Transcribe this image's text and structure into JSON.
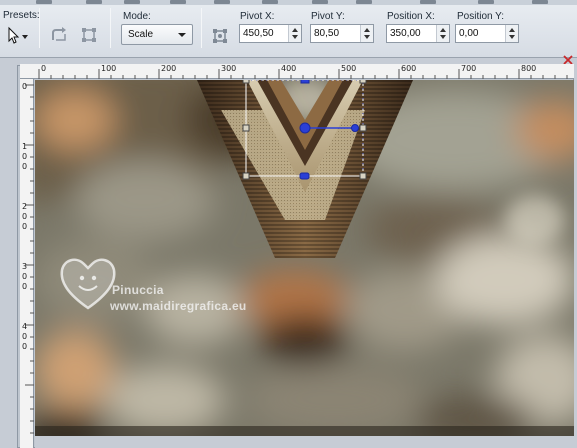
{
  "toolbar": {
    "presets_label": "Presets:",
    "mode_label": "Mode:",
    "mode_value": "Scale",
    "pivot_x_label": "Pivot X:",
    "pivot_x_value": "450,50",
    "pivot_y_label": "Pivot Y:",
    "pivot_y_value": "80,50",
    "position_x_label": "Position X:",
    "position_x_value": "350,00",
    "position_y_label": "Position Y:",
    "position_y_value": "0,00"
  },
  "ruler": {
    "h_ticks": [
      "0",
      "100",
      "200",
      "300",
      "400",
      "500",
      "600",
      "700",
      "800"
    ],
    "v_ticks": [
      [
        "0"
      ],
      [
        "1",
        "0",
        "0"
      ],
      [
        "2",
        "0",
        "0"
      ],
      [
        "3",
        "0",
        "0"
      ],
      [
        "4",
        "0",
        "0"
      ]
    ]
  },
  "watermark": {
    "line1": "Pinuccia",
    "line2": "www.maidiregrafica.eu"
  },
  "colors": {
    "handle": "#2a3fd6",
    "bbox_line": "#ffffff"
  }
}
